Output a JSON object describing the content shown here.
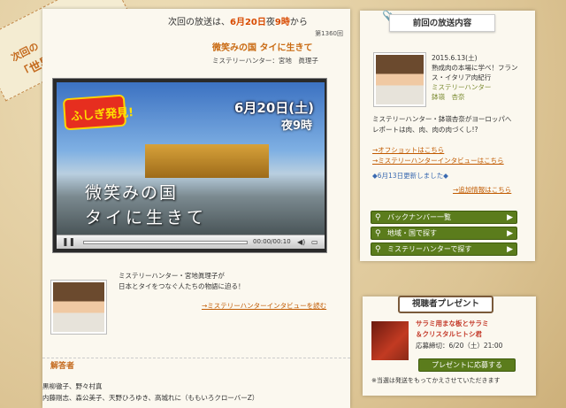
{
  "badge": {
    "line1": "次回の",
    "line2": "「世界ふしぎ発見！」"
  },
  "next": {
    "prefix": "次回の放送は、",
    "date": "6月20日",
    "mid": "夜",
    "time": "9時",
    "suffix": "から",
    "episode": "第1360回",
    "title": "微笑みの国 タイに生きて",
    "hunter": "ミステリーハンター：宮地　眞理子"
  },
  "video": {
    "logo": "ふしぎ発見!",
    "date": "6月20日(土)",
    "time": "夜9時",
    "caption1": "微笑みの国",
    "caption2": "タイに生きて",
    "elapsed": "00:00/00:10",
    "progress": 0.0
  },
  "intro": {
    "line1": "ミステリーハンター・宮地眞理子が",
    "line2": "日本とタイをつなぐ人たちの物語に迫る！",
    "link": "→ミステリーハンターインタビューを読む"
  },
  "panelists": {
    "heading": "解答者",
    "row1": "黒柳徹子、野々村真",
    "row2": "内藤剛志、森公美子、天野ひろゆき、高城れに（ももいろクローバーZ）"
  },
  "prev": {
    "heading": "前回の放送内容",
    "date": "2015.6.13(土)",
    "title": "熟成肉の本場に学べ！フランス・イタリア肉紀行",
    "role": "ミステリーハンター",
    "name": "鉢嶺　杏奈",
    "desc1": "ミステリーハンター・鉢嶺杏奈がヨーロッパへ",
    "desc2": "レポートは肉、肉、肉の肉づくし!?",
    "link1": "→オフショットはこちら",
    "link2": "→ミステリーハンターインタビューはこちら",
    "updated": "◆6月13日更新しました◆",
    "link3": "→追加情報はこちら"
  },
  "nav": [
    "バックナンバー一覧",
    "地域・国で探す",
    "ミステリーハンターで探す"
  ],
  "present": {
    "heading": "視聴者プレゼント",
    "item1": "サラミ用まな板とサラミ",
    "item2": "＆クリスタルヒトシ君",
    "deadline": "応募締切：6/20（土）21:00",
    "button": "プレゼントに応募する",
    "note": "※当選は発送をもってかえさせていただきます"
  }
}
